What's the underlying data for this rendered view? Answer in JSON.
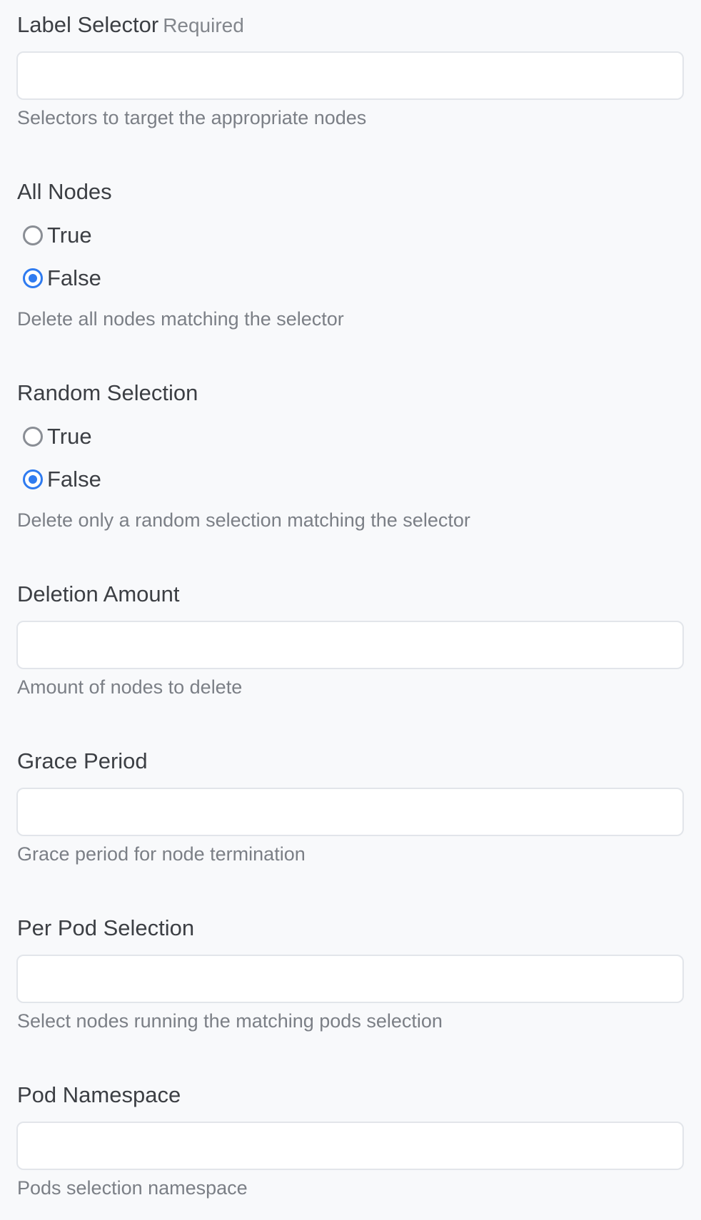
{
  "fields": {
    "label_selector": {
      "label": "Label Selector",
      "required": "Required",
      "value": "",
      "placeholder": "",
      "help": "Selectors to target the appropriate nodes"
    },
    "all_nodes": {
      "label": "All Nodes",
      "options": [
        {
          "label": "True",
          "selected": false
        },
        {
          "label": "False",
          "selected": true
        }
      ],
      "help": "Delete all nodes matching the selector"
    },
    "random_selection": {
      "label": "Random Selection",
      "options": [
        {
          "label": "True",
          "selected": false
        },
        {
          "label": "False",
          "selected": true
        }
      ],
      "help": "Delete only a random selection matching the selector"
    },
    "deletion_amount": {
      "label": "Deletion Amount",
      "value": "",
      "placeholder": "",
      "help": "Amount of nodes to delete"
    },
    "grace_period": {
      "label": "Grace Period",
      "value": "",
      "placeholder": "",
      "help": "Grace period for node termination"
    },
    "per_pod_selection": {
      "label": "Per Pod Selection",
      "value": "",
      "placeholder": "",
      "help": "Select nodes running the matching pods selection"
    },
    "pod_namespace": {
      "label": "Pod Namespace",
      "value": "",
      "placeholder": "",
      "help": "Pods selection namespace"
    }
  },
  "colors": {
    "background": "#f8f9fb",
    "accent": "#2f7bf0",
    "text": "#3c3f44",
    "muted": "#7b7f86"
  },
  "icons": {
    "radio_unchecked": "radio-unchecked-icon",
    "radio_checked": "radio-checked-icon"
  }
}
